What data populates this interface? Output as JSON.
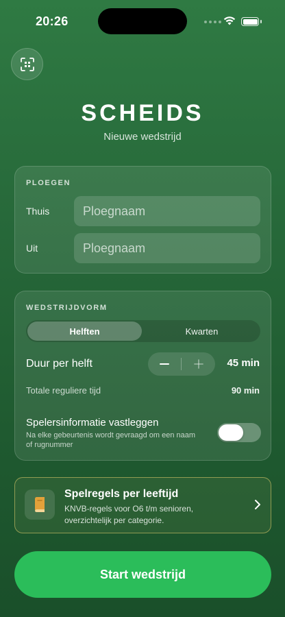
{
  "status_bar": {
    "time": "20:26",
    "battery_level": 1.0
  },
  "header": {
    "scan_icon": "qr-scan-icon",
    "title": "SCHEIDS",
    "subtitle": "Nieuwe wedstrijd"
  },
  "teams": {
    "section_title": "PLOEGEN",
    "home_label": "Thuis",
    "home_placeholder": "Ploegnaam",
    "away_label": "Uit",
    "away_placeholder": "Ploegnaam"
  },
  "format": {
    "section_title": "WEDSTRIJDVORM",
    "options": [
      "Helften",
      "Kwarten"
    ],
    "selected": "Helften",
    "duration_label": "Duur per helft",
    "duration_value": "45 min",
    "total_label": "Totale reguliere tijd",
    "total_value": "90 min",
    "player_info_title": "Spelersinformatie vastleggen",
    "player_info_desc": "Na elke gebeurtenis wordt gevraagd om een naam of rugnummer",
    "player_info_enabled": false
  },
  "rules": {
    "icon": "book-icon",
    "title": "Spelregels per leeftijd",
    "description": "KNVB-regels voor O6 t/m senioren, overzichtelijk per categorie."
  },
  "start_button": {
    "label": "Start wedstrijd"
  },
  "colors": {
    "primary_green": "#2bbd5a",
    "background_top": "#2f7a43",
    "background_bottom": "#1a4f2a",
    "accent_gold": "#e6cd6e",
    "book_orange": "#e2a13a"
  }
}
